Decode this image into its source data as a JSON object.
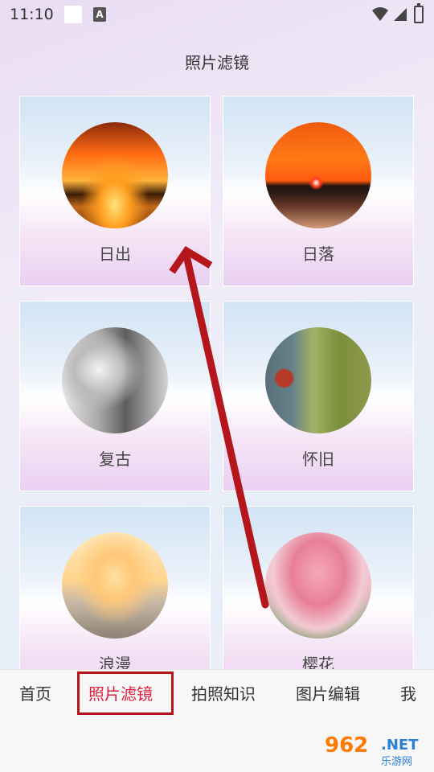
{
  "status_bar": {
    "time": "11:10",
    "notification_glyph": "A",
    "icons": [
      "notification-square-icon",
      "a-notification-icon",
      "wifi-icon",
      "signal-icon",
      "battery-icon"
    ]
  },
  "page": {
    "title": "照片滤镜"
  },
  "filters": [
    {
      "label": "日出",
      "thumb": "sunrise-photo"
    },
    {
      "label": "日落",
      "thumb": "sunset-photo"
    },
    {
      "label": "复古",
      "thumb": "retro-portrait-photo"
    },
    {
      "label": "怀旧",
      "thumb": "nostalgia-street-photo"
    },
    {
      "label": "浪漫",
      "thumb": "romance-couple-photo"
    },
    {
      "label": "樱花",
      "thumb": "sakura-tree-photo"
    }
  ],
  "tabs": [
    {
      "label": "首页"
    },
    {
      "label": "照片滤镜",
      "active": true
    },
    {
      "label": "拍照知识"
    },
    {
      "label": "图片编辑"
    },
    {
      "label": "我"
    }
  ],
  "colors": {
    "active_tab": "#d9213f",
    "annotation_red": "#b5161c",
    "watermark_orange": "#ff7a00",
    "watermark_blue": "#2a7fd6"
  },
  "watermark": {
    "number": "962",
    "suffix": ".NET",
    "site": "乐游网"
  }
}
